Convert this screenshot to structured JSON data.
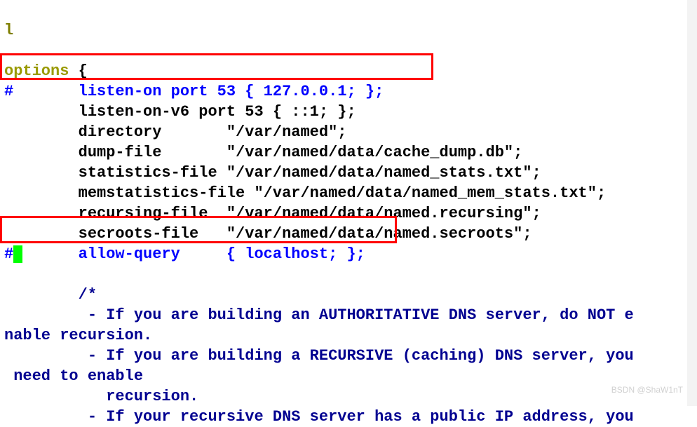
{
  "lines": {
    "l0": "l",
    "options": "options",
    "brace_open": " {",
    "hash1": "#",
    "line_listen": "       listen-on port 53 { 127.0.0.1; };",
    "line_listen_v6": "        listen-on-v6 port 53 { ::1; };",
    "line_directory": "        directory       \"/var/named\";",
    "line_dumpfile": "        dump-file       \"/var/named/data/cache_dump.db\";",
    "line_statsfile": "        statistics-file \"/var/named/data/named_stats.txt\";",
    "line_memstats": "        memstatistics-file \"/var/named/data/named_mem_stats.txt\";",
    "line_recursing": "        recursing-file  \"/var/named/data/named.recursing\";",
    "line_secroots": "        secroots-file   \"/var/named/data/named.secroots\";",
    "hash2a": "#",
    "hash2b": " ",
    "line_allowquery": "      allow-query     { localhost; };",
    "blank": "",
    "line_comment_open": "        /*",
    "line_c1": "         - If you are building an AUTHORITATIVE DNS server, do NOT e",
    "line_c1b": "nable recursion.",
    "line_c2": "         - If you are building a RECURSIVE (caching) DNS server, you",
    "line_c2b": " need to enable",
    "line_c3": "           recursion.",
    "line_c4": "         - If your recursive DNS server has a public IP address, you"
  },
  "watermark": "BSDN @ShaW1nT"
}
